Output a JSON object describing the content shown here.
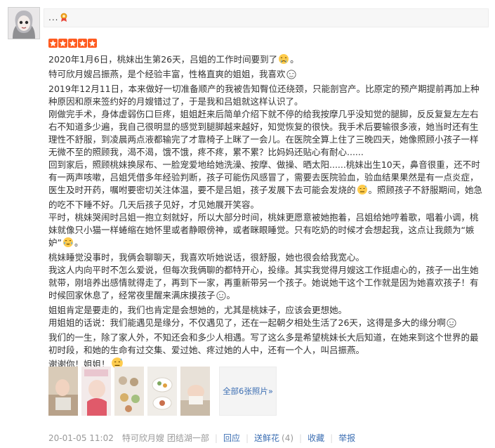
{
  "user": {
    "name_masked": "...",
    "vip_icon": "award-icon"
  },
  "rating": {
    "stars": 5,
    "max": 5,
    "color": "#ff5b20"
  },
  "review": {
    "paragraphs": [
      "2020年1月6日，桃妹出生第26天，吕姐的工作时间要到了",
      "特可欣月嫂吕振燕，是个经验丰富，性格直爽的姐姐，我喜欢",
      "2019年12月11日，本来做好一切准备顺产的我被告知臀位还绕颈，只能剖宫产。比原定的预产期提前再加上种种原因和原来签约好的月嫂错过了，于是我和吕姐就这样认识了。",
      "刚做完手术，身体虚弱伤口巨疼，姐姐赶来后简单介绍下就不停的给我按摩几乎没知觉的腿脚，反反复复左左右右不知道多少遍，我自己很明显的感觉到腿脚越来越好，知觉恢复的很快。我手术后要输很多液，她当时还有生理性不舒服，到凌晨两点液都输完了才靠椅子上眯了一会儿。在医院全算上住了三晚四天，她像照顾小孩子一样无微不至的照顾我，渴不渴，饿不饿，疼不疼，累不累？比妈妈还贴心有耐心......",
      "回到家后，照顾桃妹换尿布、一脸宠爱地给她洗澡、按摩、做操、晒太阳......桃妹出生10天，鼻音很重，还不时有一两声咳嗽，吕姐凭借多年经验判断，孩子可能伤风感冒了，需要去医院验血，验血结果果然是有一点炎症，医生及时开药，嘱咐要密切关注体温，要不是吕姐，孩子发展下去可能会发烧的",
      "照顾孩子不舒服期间，她急的吃不下睡不好。几天后孩子见好，才见她展开笑容。",
      "平时，桃妹哭闹时吕姐一抱立刻就好，所以大部分时间，桃妹更愿意被她抱着，吕姐给她哼着歌，唱着小调，桃妹就像只小猫一样蜷缩在她怀里或者静眼傍神，或者眯眼睡觉。只有吃奶的时候才会想起我，这点让我颇为“嫉妒”",
      "桃妹睡觉没事时，我俩会聊聊天，我喜欢听她说话，很舒服，她也很会给我宽心。",
      "我这人内向平时不怎么爱说，但每次我俩聊的都特开心，投缘。其实我觉得月嫂这工作挺虐心的，孩子一出生她就带，刚培养出感情就得走了，再到下一家，再重新带另一个孩子。她说她干这个工作就是因为她喜欢孩子！有时候回家休息了，经常夜里醒来满床摸孩子",
      "姐姐肯定是要走的，我们也肯定是会想她的，尤其是桃妹子，应该会更想她。",
      "用姐姐的话说：我们能遇见是缘分，不仅遇见了，还在一起朝夕相处生活了26天，这得是多大的缘分啊",
      "我们的一生，除了家人外，不知还会和多少人相遇。写了这么多是希望桃妹长大后知道，在她来到这个世界的最初时段，和她的生命有过交集、爱过她、疼过她的人中，还有一个人，叫吕振燕。",
      "谢谢你！姐姐！"
    ]
  },
  "photos": {
    "thumbs": [
      "photo-1",
      "photo-2",
      "photo-3",
      "photo-4",
      "photo-5"
    ],
    "more_label": "全部6张照片»"
  },
  "footer": {
    "date": "20-01-05 11:02",
    "author": "特可欣月嫂",
    "group": "团结湖一部",
    "reply": "回应",
    "flowers": "送鲜花",
    "flowers_count": "(4)",
    "favorite": "收藏",
    "report": "举报"
  },
  "colors": {
    "accent_link": "#3d6fb3",
    "muted": "#999999",
    "text": "#333333"
  }
}
